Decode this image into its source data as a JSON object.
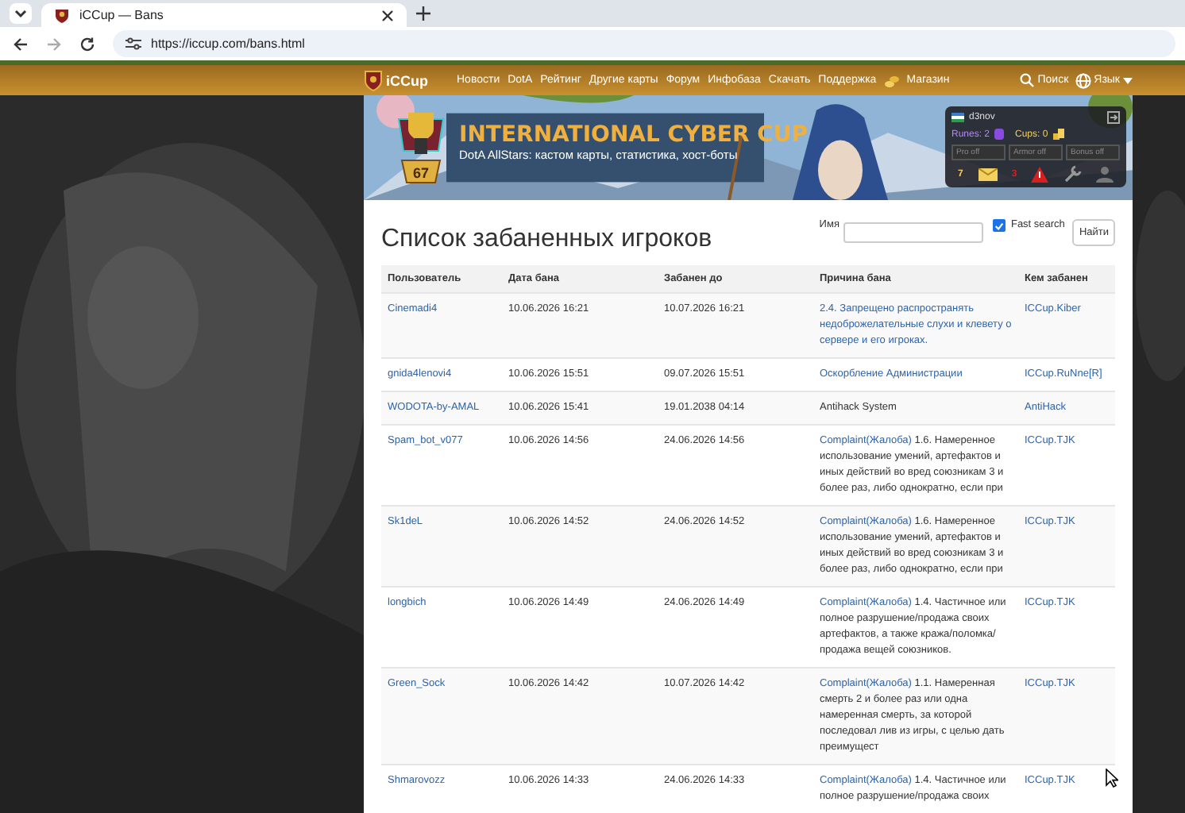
{
  "browser": {
    "tab_title": "iCCup — Bans",
    "url": "https://iccup.com/bans.html"
  },
  "nav": {
    "logo": "iCCup",
    "items": [
      "Новости",
      "DotA",
      "Рейтинг",
      "Другие карты",
      "Форум",
      "Инфобаза",
      "Скачать",
      "Поддержка",
      "Магазин"
    ],
    "search": "Поиск",
    "language": "Язык"
  },
  "banner": {
    "level": "67",
    "title": "INTERNATIONAL CYBER CUP",
    "subtitle": "DotA AllStars: кастом карты, статистика, хост-боты"
  },
  "user_panel": {
    "username": "d3nov",
    "runes": "Runes: 2",
    "cups": "Cups: 0",
    "toggles": [
      {
        "label": "Pro off",
        "on": false
      },
      {
        "label": "Armor off",
        "on": false
      },
      {
        "label": "Bonus off",
        "on": false
      }
    ],
    "messages": "7",
    "warnings": "3"
  },
  "page": {
    "title": "Список забаненных игроков",
    "search_label": "Имя",
    "fast_search": {
      "label": "Fast search",
      "checked": true
    },
    "search_button": "Найти"
  },
  "table": {
    "columns": [
      "Пользователь",
      "Дата бана",
      "Забанен до",
      "Причина бана",
      "Кем забанен"
    ],
    "rows": [
      {
        "user": "Cinemadi4",
        "date": "10.06.2026 16:21",
        "until": "10.07.2026 16:21",
        "reason_link": "2.4. Запрещено распространять недоброжелательные слухи и клевету о сервере и его игроках.",
        "by": "ICCup.Kiber"
      },
      {
        "user": "gnida4lenovi4",
        "date": "10.06.2026 15:51",
        "until": "09.07.2026 15:51",
        "reason_link": "Оскорбление Администрации",
        "by": "ICCup.RuNne[R]"
      },
      {
        "user": "WODOTA-by-AMAL",
        "date": "10.06.2026 15:41",
        "until": "19.01.2038 04:14",
        "reason_text": "Antihack System",
        "by": "AntiHack"
      },
      {
        "user": "Spam_bot_v077",
        "date": "10.06.2026 14:56",
        "until": "24.06.2026 14:56",
        "reason_link": "Complaint(Жалоба)",
        "reason_text": "1.6. Намеренное использование умений, артефактов и иных действий во вред союзникам 3 и более раз, либо однократно, если при",
        "by": "ICCup.TJK"
      },
      {
        "user": "Sk1deL",
        "date": "10.06.2026 14:52",
        "until": "24.06.2026 14:52",
        "reason_link": "Complaint(Жалоба)",
        "reason_text": "1.6. Намеренное использование умений, артефактов и иных действий во вред союзникам 3 и более раз, либо однократно, если при",
        "by": "ICCup.TJK"
      },
      {
        "user": "longbich",
        "date": "10.06.2026 14:49",
        "until": "24.06.2026 14:49",
        "reason_link": "Complaint(Жалоба)",
        "reason_text": "1.4. Частичное или полное разрушение/продажа своих артефактов, а также кража/поломка/ продажа вещей союзников.",
        "by": "ICCup.TJK"
      },
      {
        "user": "Green_Sock",
        "date": "10.06.2026 14:42",
        "until": "10.07.2026 14:42",
        "reason_link": "Complaint(Жалоба)",
        "reason_text": "1.1. Намеренная смерть 2 и более раз или одна намеренная смерть, за которой последовал лив из игры, с целью дать преимущест",
        "by": "ICCup.TJK"
      },
      {
        "user": "Shmarovozz",
        "date": "10.06.2026 14:33",
        "until": "24.06.2026 14:33",
        "reason_link": "Complaint(Жалоба)",
        "reason_text": "1.4. Частичное или полное разрушение/продажа своих",
        "by": "ICCup.TJK"
      }
    ]
  }
}
